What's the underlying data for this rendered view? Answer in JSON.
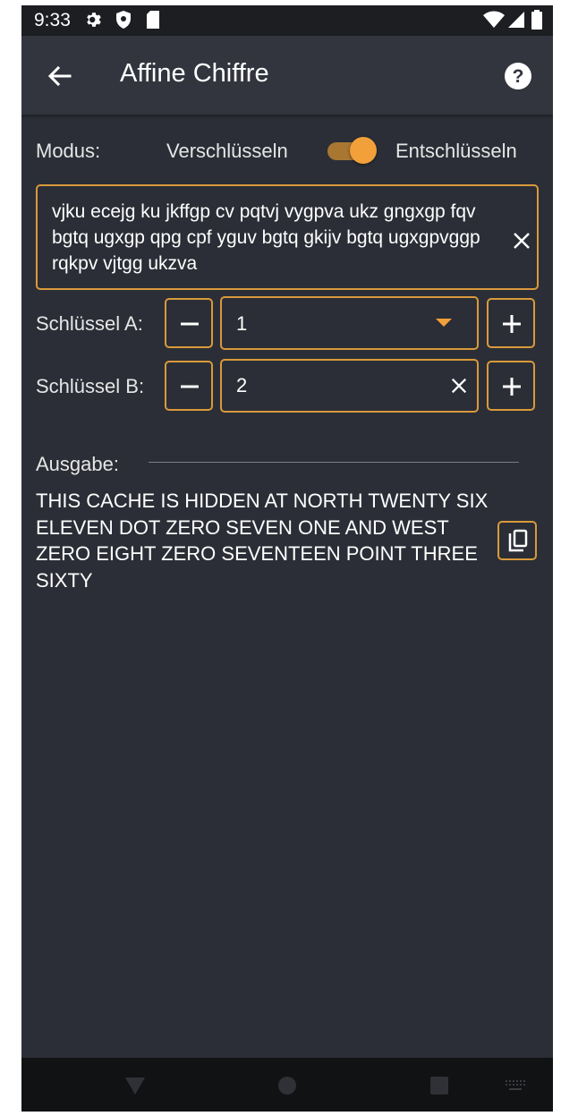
{
  "status_bar": {
    "time": "9:33",
    "icons": [
      "gear-icon",
      "shield-icon",
      "sd-card-icon",
      "wifi-icon",
      "signal-icon",
      "battery-icon"
    ]
  },
  "app_bar": {
    "title": "Affine Chiffre",
    "back_icon": "arrow-left-icon",
    "help_icon": "help-circle-icon"
  },
  "mode": {
    "label": "Modus:",
    "option_left": "Verschlüsseln",
    "option_right": "Entschlüsseln",
    "toggle_on": true
  },
  "input": {
    "value": "vjku ecejg ku jkffgp cv pqtvj vygpva ukz gngxgp fqv bgtq ugxgp qpg cpf yguv bgtq gkijv bgtq ugxgpvggp rqkpv vjtgg ukzva"
  },
  "key_a": {
    "label": "Schlüssel A:",
    "value": "1"
  },
  "key_b": {
    "label": "Schlüssel B:",
    "value": "2"
  },
  "output": {
    "label": "Ausgabe:",
    "value": "THIS CACHE IS HIDDEN AT NORTH TWENTY SIX ELEVEN DOT ZERO SEVEN ONE AND WEST ZERO EIGHT ZERO SEVENTEEN POINT THREE SIXTY"
  },
  "colors": {
    "background": "#2b2e36",
    "accent": "#d99a3b",
    "toolbar": "#32353d",
    "text": "#ffffff"
  }
}
